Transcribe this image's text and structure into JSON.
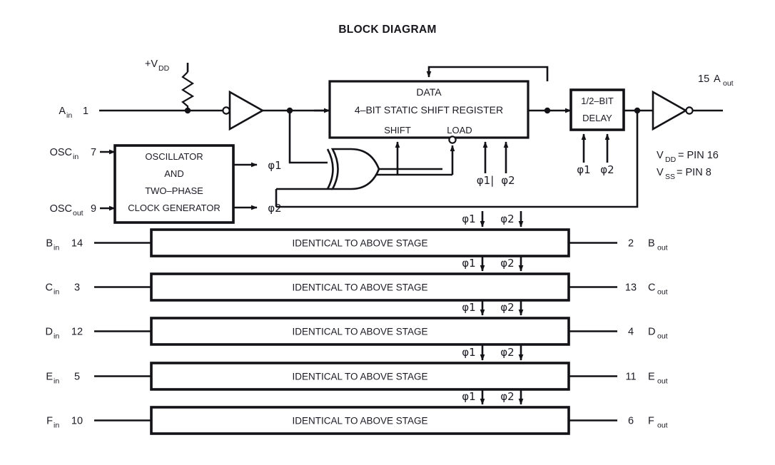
{
  "title": "BLOCK DIAGRAM",
  "power": {
    "vdd_supply_label": "+V",
    "vdd_supply_sub": "DD",
    "notes": [
      {
        "sym": "V",
        "sub": "DD",
        "text": " = PIN 16"
      },
      {
        "sym": "V",
        "sub": "SS",
        "text": " = PIN 8"
      }
    ]
  },
  "inputs": {
    "a_in": {
      "sym": "A",
      "sub": "in",
      "pin": "1"
    },
    "osc_in": {
      "sym": "OSC",
      "sub": "in",
      "pin": "7"
    },
    "osc_out": {
      "sym": "OSC",
      "sub": "out",
      "pin": "9"
    }
  },
  "outputs": {
    "a_out": {
      "pin": "15",
      "sym": "A",
      "sub": "out"
    }
  },
  "blocks": {
    "shift_register": {
      "line1": "DATA",
      "line2": "4–BIT STATIC SHIFT REGISTER",
      "shift_label": "SHIFT",
      "load_label": "LOAD"
    },
    "oscillator": {
      "line1": "OSCILLATOR",
      "line2": "AND",
      "line3": "TWO–PHASE",
      "line4": "CLOCK GENERATOR"
    },
    "delay": {
      "line1": "1/2–BIT",
      "line2": "DELAY"
    }
  },
  "clocks": {
    "phi1": "φ1",
    "phi2": "φ2",
    "phi1_bar": "φ1|",
    "osc_out_phi1": "φ1",
    "osc_out_phi2": "φ2"
  },
  "stages": [
    {
      "in_sym": "B",
      "in_sub": "in",
      "in_pin": "14",
      "label": "IDENTICAL TO ABOVE STAGE",
      "out_pin": "2",
      "out_sym": "B",
      "out_sub": "out"
    },
    {
      "in_sym": "C",
      "in_sub": "in",
      "in_pin": "3",
      "label": "IDENTICAL TO ABOVE STAGE",
      "out_pin": "13",
      "out_sym": "C",
      "out_sub": "out"
    },
    {
      "in_sym": "D",
      "in_sub": "in",
      "in_pin": "12",
      "label": "IDENTICAL TO ABOVE STAGE",
      "out_pin": "4",
      "out_sym": "D",
      "out_sub": "out"
    },
    {
      "in_sym": "E",
      "in_sub": "in",
      "in_pin": "5",
      "label": "IDENTICAL TO ABOVE STAGE",
      "out_pin": "11",
      "out_sym": "E",
      "out_sub": "out"
    },
    {
      "in_sym": "F",
      "in_sub": "in",
      "in_pin": "10",
      "label": "IDENTICAL TO ABOVE STAGE",
      "out_pin": "6",
      "out_sym": "F",
      "out_sub": "out"
    }
  ],
  "icons": {
    "resistor": "resistor-icon",
    "xor_gate": "xor-gate-icon",
    "inverter": "inverter-icon",
    "buffer": "buffer-icon"
  },
  "colors": {
    "ink": "#121217",
    "background": "#ffffff"
  }
}
